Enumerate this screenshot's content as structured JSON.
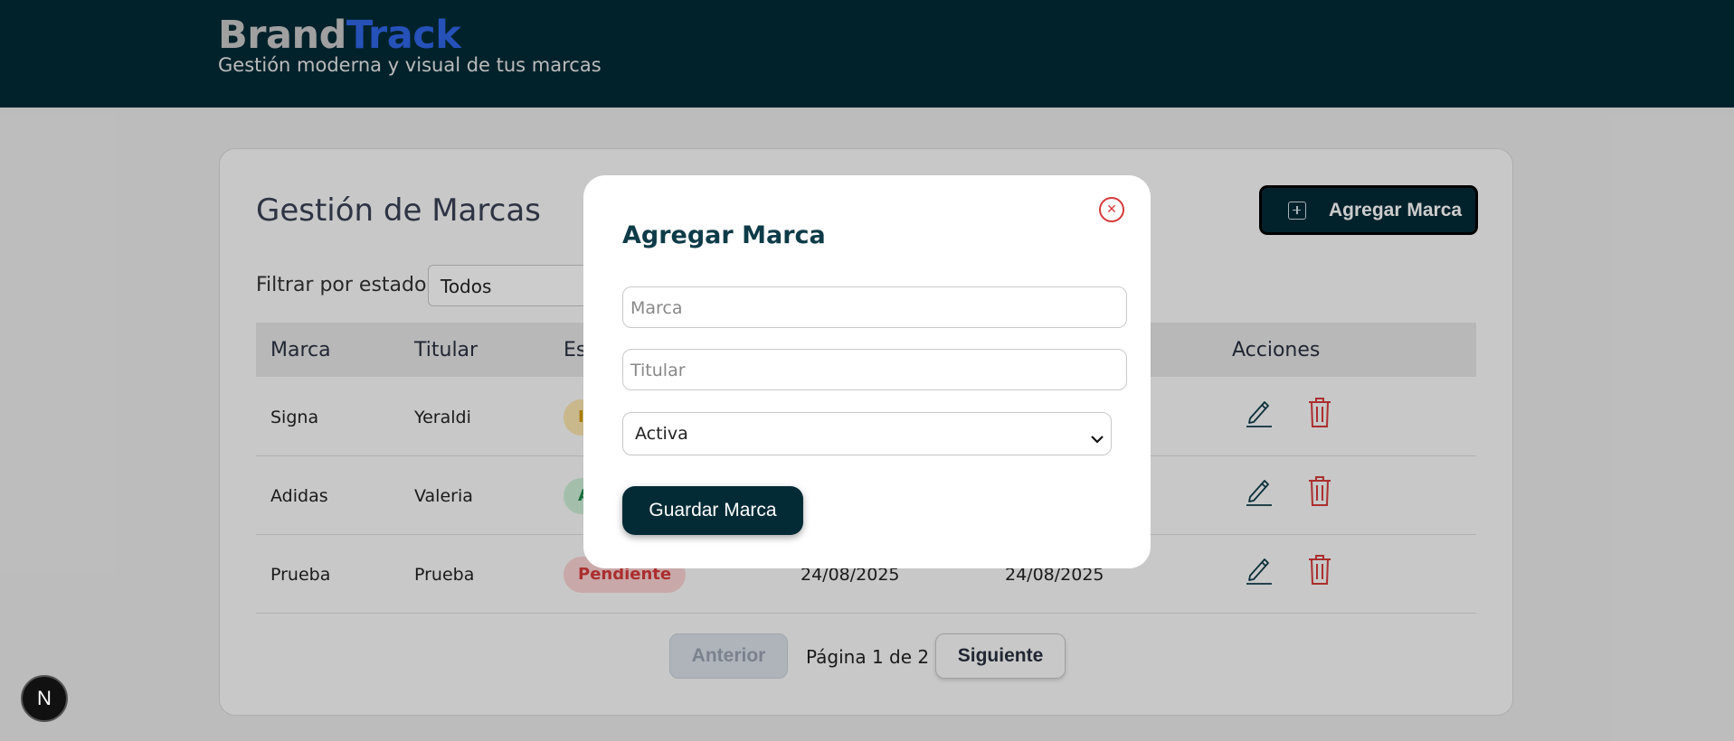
{
  "header": {
    "brand_part1": "Brand",
    "brand_part2": "Track",
    "tagline": "Gestión moderna y visual de tus marcas"
  },
  "main": {
    "title": "Gestión de Marcas",
    "add_button_label": "Agregar Marca",
    "add_button_icon": "plus-square-icon",
    "filter_label": "Filtrar por estado:",
    "filter_value": "Todos"
  },
  "table": {
    "columns": [
      "Marca",
      "Titular",
      "Estado",
      "",
      "",
      "Acciones"
    ],
    "visible_headers": {
      "marca": "Marca",
      "titular": "Titular",
      "estado_partial": "Es",
      "acciones": "Acciones"
    },
    "rows": [
      {
        "marca": "Signa",
        "titular": "Yeraldi",
        "estado_partial": "I",
        "estado_color": "#d29b00",
        "badge_bg": "#fbe7b0",
        "fecha1": "",
        "fecha2": ""
      },
      {
        "marca": "Adidas",
        "titular": "Valeria",
        "estado_partial": "A",
        "estado_color": "#1f8a4c",
        "badge_bg": "#cdeed8",
        "fecha1": "",
        "fecha2": ""
      },
      {
        "marca": "Prueba",
        "titular": "Prueba",
        "estado": "Pendiente",
        "estado_color": "#d63a3a",
        "badge_bg": "#fbd3d3",
        "fecha1": "24/08/2025",
        "fecha2": "24/08/2025"
      }
    ],
    "row_actions": {
      "edit_icon": "pencil-icon",
      "delete_icon": "trash-icon"
    }
  },
  "pagination": {
    "prev_label": "Anterior",
    "page_info": "Página 1 de 2",
    "next_label": "Siguiente"
  },
  "modal": {
    "title": "Agregar Marca",
    "close_icon": "close-circle-icon",
    "marca_placeholder": "Marca",
    "titular_placeholder": "Titular",
    "estado_value": "Activa",
    "save_label": "Guardar Marca"
  },
  "fab": {
    "label": "N"
  },
  "colors": {
    "header_bg": "#032b36",
    "brand_accent": "#2f66e8",
    "primary_button": "#032b36",
    "danger": "#d63a3a"
  }
}
